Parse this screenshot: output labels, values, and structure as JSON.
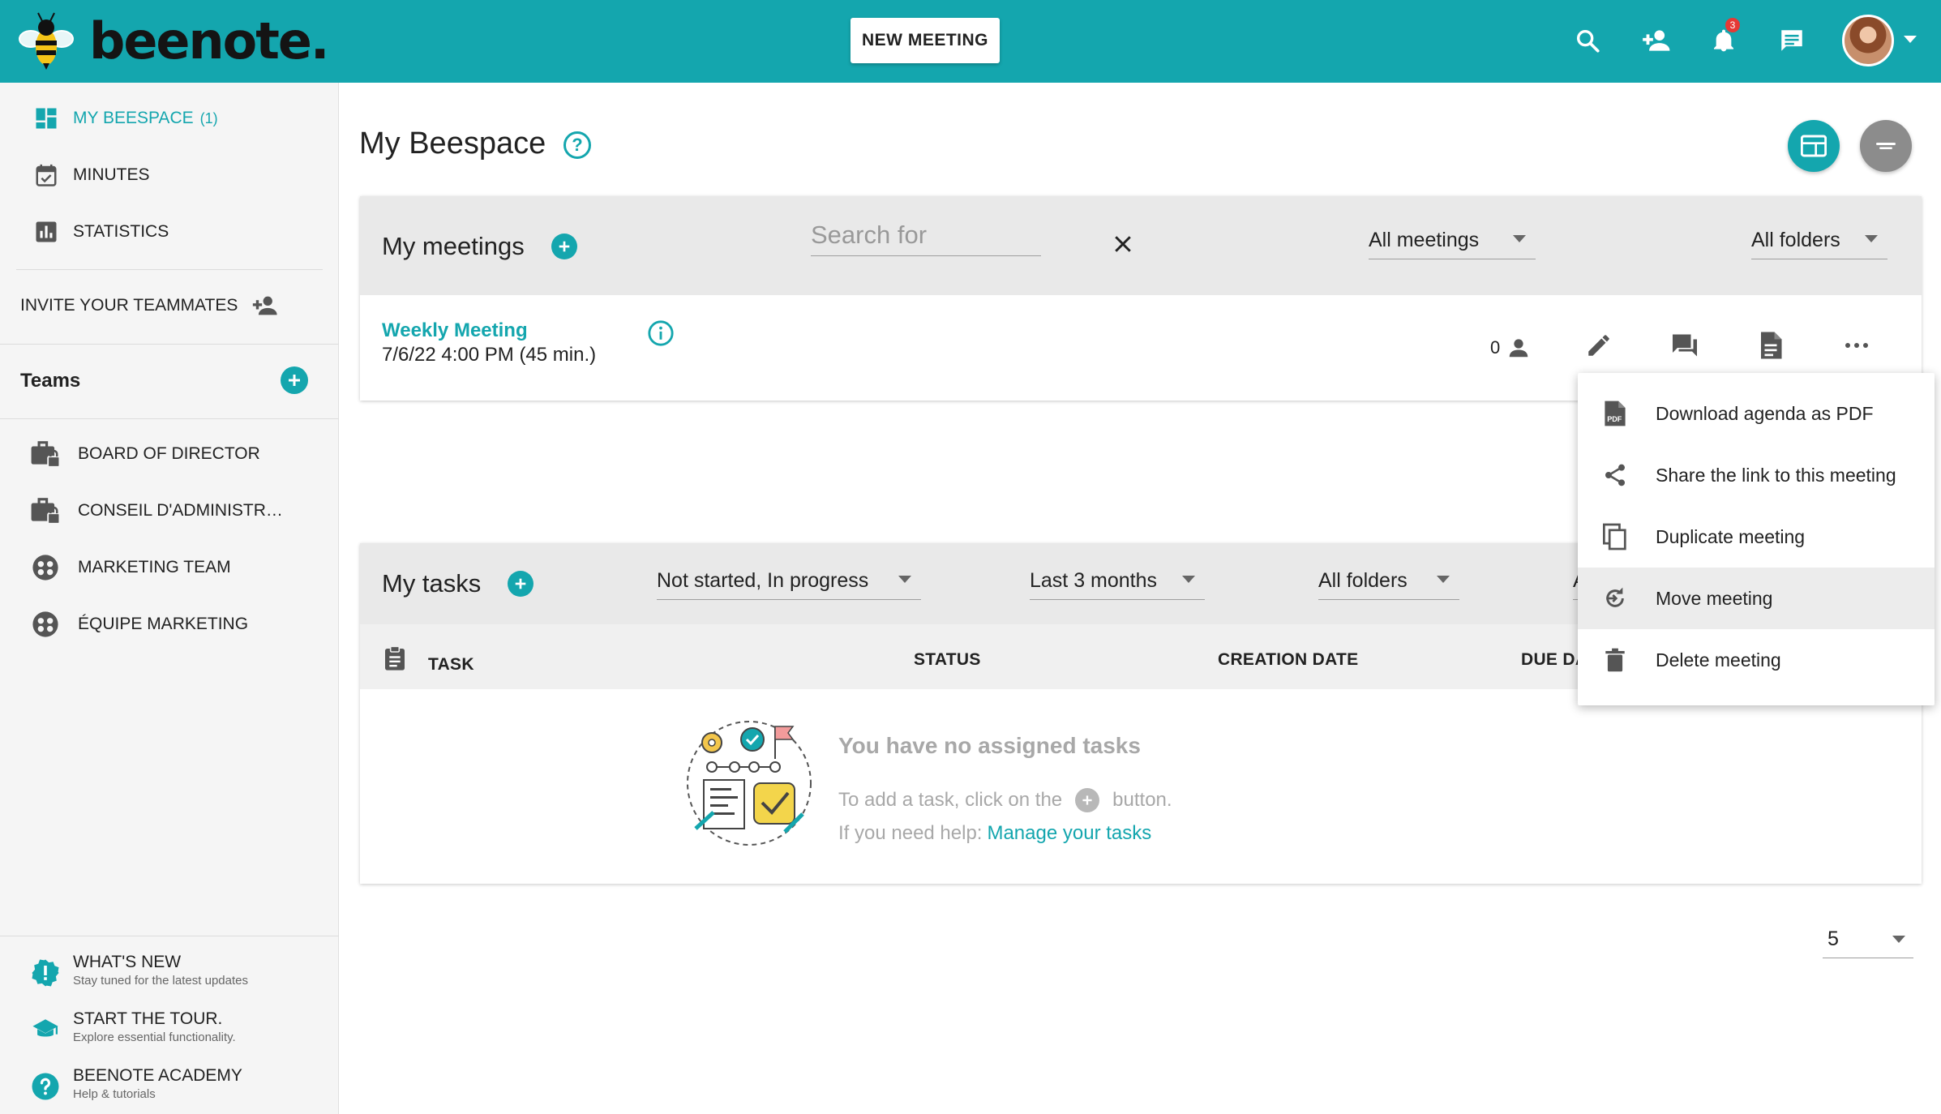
{
  "app": {
    "name": "beenote.",
    "new_meeting_label": "NEW MEETING",
    "notification_count": "3",
    "accent_color": "#14a6ae"
  },
  "sidebar": {
    "nav": [
      {
        "label": "MY BEESPACE",
        "count": "(1)",
        "icon": "dashboard-icon",
        "active": true
      },
      {
        "label": "MINUTES",
        "icon": "calendar-check-icon"
      },
      {
        "label": "STATISTICS",
        "icon": "bar-chart-icon"
      }
    ],
    "invite_label": "INVITE YOUR TEAMMATES",
    "teams_title": "Teams",
    "teams": [
      {
        "label": "BOARD OF DIRECTOR",
        "icon": "locked-briefcase-icon"
      },
      {
        "label": "CONSEIL D'ADMINISTR…",
        "icon": "locked-briefcase-icon"
      },
      {
        "label": "MARKETING TEAM",
        "icon": "team-icon"
      },
      {
        "label": "ÉQUIPE MARKETING",
        "icon": "team-icon"
      }
    ],
    "footer": [
      {
        "title": "WHAT'S NEW",
        "subtitle": "Stay tuned for the latest updates",
        "icon": "new-badge-icon"
      },
      {
        "title": "START THE TOUR.",
        "subtitle": "Explore essential functionality.",
        "icon": "graduation-cap-icon"
      },
      {
        "title": "BEENOTE ACADEMY",
        "subtitle": "Help & tutorials",
        "icon": "help-icon"
      }
    ]
  },
  "main": {
    "page_title": "My Beespace",
    "meetings": {
      "title": "My meetings",
      "search_placeholder": "Search for",
      "filter_meetings": "All meetings",
      "filter_folders": "All folders",
      "items": [
        {
          "title": "Weekly Meeting",
          "datetime": "7/6/22 4:00 PM (45 min.)",
          "participants": "0"
        }
      ]
    },
    "tasks": {
      "title": "My tasks",
      "filter_status": "Not started, In progress",
      "filter_period": "Last 3 months",
      "filter_folders": "All folders",
      "filter_partial": "A",
      "columns": [
        "TASK",
        "STATUS",
        "CREATION DATE",
        "DUE DA"
      ],
      "empty_title": "You have no assigned tasks",
      "empty_hint_before": "To add a task, click on the",
      "empty_hint_after": "button.",
      "help_prefix": "If you need help:",
      "help_link": "Manage your tasks"
    },
    "page_size": "5"
  },
  "context_menu": [
    {
      "label": "Download agenda as PDF",
      "icon": "pdf-file-icon"
    },
    {
      "label": "Share the link to this meeting",
      "icon": "share-icon"
    },
    {
      "label": "Duplicate meeting",
      "icon": "copy-icon"
    },
    {
      "label": "Move meeting",
      "icon": "move-icon",
      "highlighted": true
    },
    {
      "label": "Delete meeting",
      "icon": "trash-icon"
    }
  ]
}
